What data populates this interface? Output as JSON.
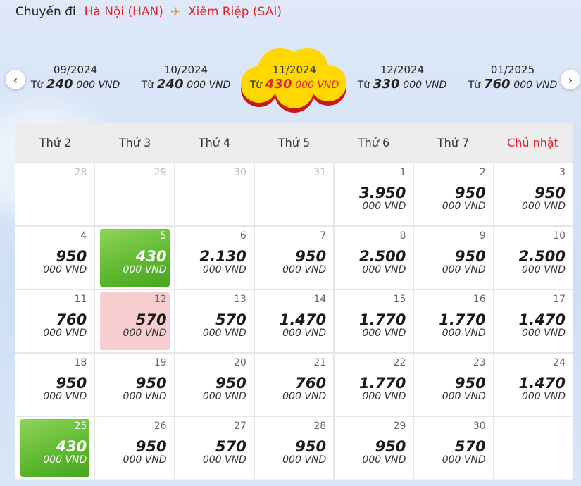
{
  "route": {
    "label": "Chuyến đi",
    "origin": "Hà Nội (HAN)",
    "destination": "Xiêm Riệp (SAI)",
    "plane_icon": "plane-icon"
  },
  "months": [
    {
      "month": "09/2024",
      "from": "Từ",
      "amount": "240",
      "unit": "000 VND",
      "active": false
    },
    {
      "month": "10/2024",
      "from": "Từ",
      "amount": "240",
      "unit": "000 VND",
      "active": false
    },
    {
      "month": "11/2024",
      "from": "Từ",
      "amount": "430",
      "unit": "000 VND",
      "active": true
    },
    {
      "month": "12/2024",
      "from": "Từ",
      "amount": "330",
      "unit": "000 VND",
      "active": false
    },
    {
      "month": "01/2025",
      "from": "Từ",
      "amount": "760",
      "unit": "000 VND",
      "active": false
    }
  ],
  "weekdays": [
    "Thứ 2",
    "Thứ 3",
    "Thứ 4",
    "Thứ 5",
    "Thứ 6",
    "Thứ 7",
    "Chủ nhật"
  ],
  "colors": {
    "accent": "#e0262b",
    "cheapest": "#5cb82e",
    "highlight": "#f7cdd0",
    "cloud": "#ffd800"
  },
  "days": [
    {
      "day": "28",
      "dim": true,
      "price": "",
      "unit": ""
    },
    {
      "day": "29",
      "dim": true,
      "price": "",
      "unit": ""
    },
    {
      "day": "30",
      "dim": true,
      "price": "",
      "unit": ""
    },
    {
      "day": "31",
      "dim": true,
      "price": "",
      "unit": ""
    },
    {
      "day": "1",
      "price": "3.950",
      "unit": "000 VND"
    },
    {
      "day": "2",
      "price": "950",
      "unit": "000 VND"
    },
    {
      "day": "3",
      "price": "950",
      "unit": "000 VND"
    },
    {
      "day": "4",
      "price": "950",
      "unit": "000 VND"
    },
    {
      "day": "5",
      "price": "430",
      "unit": "000 VND",
      "mark": "green"
    },
    {
      "day": "6",
      "price": "2.130",
      "unit": "000 VND"
    },
    {
      "day": "7",
      "price": "950",
      "unit": "000 VND"
    },
    {
      "day": "8",
      "price": "2.500",
      "unit": "000 VND"
    },
    {
      "day": "9",
      "price": "950",
      "unit": "000 VND"
    },
    {
      "day": "10",
      "price": "2.500",
      "unit": "000 VND"
    },
    {
      "day": "11",
      "price": "760",
      "unit": "000 VND"
    },
    {
      "day": "12",
      "price": "570",
      "unit": "000 VND",
      "mark": "pink"
    },
    {
      "day": "13",
      "price": "570",
      "unit": "000 VND"
    },
    {
      "day": "14",
      "price": "1.470",
      "unit": "000 VND"
    },
    {
      "day": "15",
      "price": "1.770",
      "unit": "000 VND"
    },
    {
      "day": "16",
      "price": "1.770",
      "unit": "000 VND"
    },
    {
      "day": "17",
      "price": "1.470",
      "unit": "000 VND"
    },
    {
      "day": "18",
      "price": "950",
      "unit": "000 VND"
    },
    {
      "day": "19",
      "price": "950",
      "unit": "000 VND"
    },
    {
      "day": "20",
      "price": "950",
      "unit": "000 VND"
    },
    {
      "day": "21",
      "price": "760",
      "unit": "000 VND"
    },
    {
      "day": "22",
      "price": "1.770",
      "unit": "000 VND"
    },
    {
      "day": "23",
      "price": "950",
      "unit": "000 VND"
    },
    {
      "day": "24",
      "price": "1.470",
      "unit": "000 VND"
    },
    {
      "day": "25",
      "price": "430",
      "unit": "000 VND",
      "mark": "green"
    },
    {
      "day": "26",
      "price": "950",
      "unit": "000 VND"
    },
    {
      "day": "27",
      "price": "570",
      "unit": "000 VND"
    },
    {
      "day": "28",
      "price": "950",
      "unit": "000 VND"
    },
    {
      "day": "29",
      "price": "950",
      "unit": "000 VND"
    },
    {
      "day": "30",
      "price": "570",
      "unit": "000 VND"
    },
    {
      "day": "",
      "dim": true,
      "price": "",
      "unit": ""
    }
  ]
}
